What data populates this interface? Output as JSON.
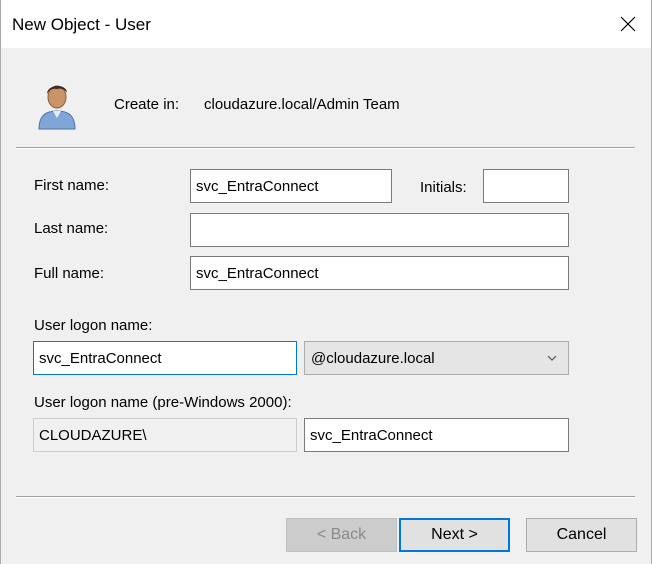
{
  "window": {
    "title": "New Object - User"
  },
  "header": {
    "create_in_label": "Create in:",
    "create_in_path": "cloudazure.local/Admin Team",
    "icon": "user-icon"
  },
  "form": {
    "first_name": {
      "label": "First name:",
      "value": "svc_EntraConnect"
    },
    "initials": {
      "label": "Initials:",
      "value": ""
    },
    "last_name": {
      "label": "Last name:",
      "value": ""
    },
    "full_name": {
      "label": "Full name:",
      "value": "svc_EntraConnect"
    },
    "logon_name": {
      "label": "User logon name:",
      "value": "svc_EntraConnect",
      "domain_selected": "@cloudazure.local"
    },
    "pre2000": {
      "label": "User logon name (pre-Windows 2000):",
      "domain_prefix": "CLOUDAZURE\\",
      "value": "svc_EntraConnect"
    }
  },
  "buttons": {
    "back": "< Back",
    "next": "Next >",
    "cancel": "Cancel"
  },
  "colors": {
    "focus_accent": "#0078d7",
    "dialog_background": "#f0f0f0"
  }
}
